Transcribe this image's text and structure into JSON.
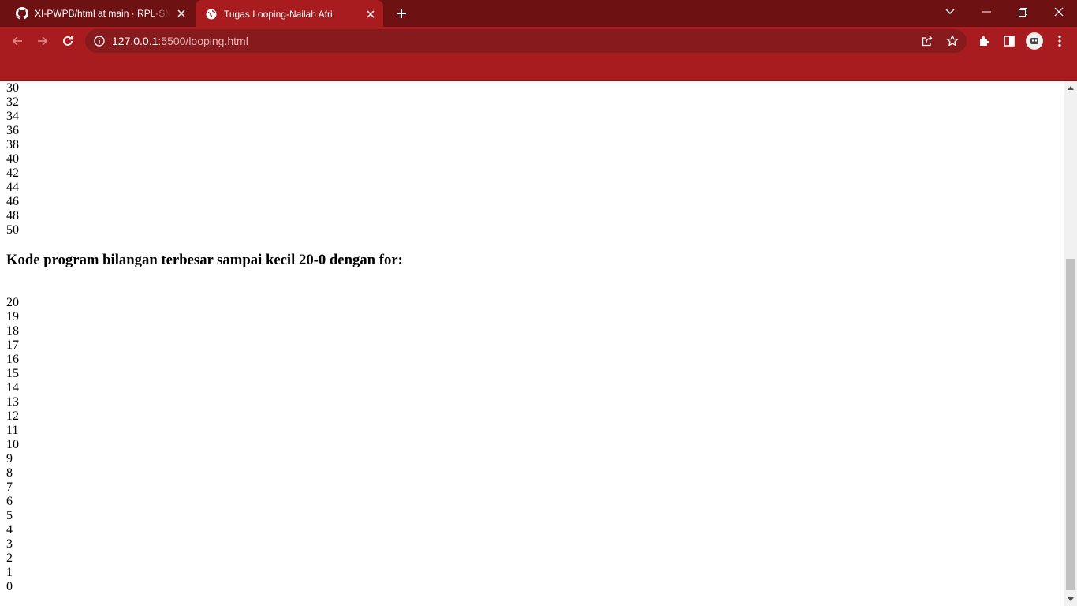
{
  "browser": {
    "tabs": [
      {
        "title": "XI-PWPB/html at main · RPL-SMK",
        "favicon": "github-icon",
        "active": false
      },
      {
        "title": "Tugas Looping-Nailah Afri",
        "favicon": "globe-icon",
        "active": true
      }
    ],
    "url_host": "127.0.0.1",
    "url_rest": ":5500/looping.html",
    "colors": {
      "frame": "#6e1113",
      "toolbar": "#a81c20",
      "omnibox": "#871a1c"
    }
  },
  "page": {
    "even_numbers_tail": [
      "30",
      "32",
      "34",
      "36",
      "38",
      "40",
      "42",
      "44",
      "46",
      "48",
      "50"
    ],
    "heading": "Kode program bilangan terbesar sampai kecil 20-0 dengan for:",
    "countdown": [
      "20",
      "19",
      "18",
      "17",
      "16",
      "15",
      "14",
      "13",
      "12",
      "11",
      "10",
      "9",
      "8",
      "7",
      "6",
      "5",
      "4",
      "3",
      "2",
      "1",
      "0"
    ]
  }
}
